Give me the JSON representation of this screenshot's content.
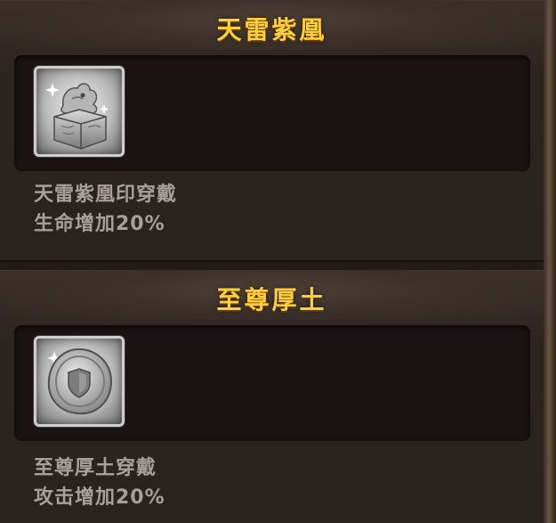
{
  "sets": [
    {
      "title": "天雷紫凰",
      "item_icon": "seal-icon",
      "description_line1": "天雷紫凰印穿戴",
      "description_line2": "生命增加20%"
    },
    {
      "title": "至尊厚土",
      "item_icon": "shield-coin-icon",
      "description_line1": "至尊厚土穿戴",
      "description_line2": "攻击增加20%"
    }
  ],
  "colors": {
    "title": "#ffcf3a",
    "description": "#a89f9b",
    "panel": "#2c241f",
    "slot_background": "#1b1214"
  }
}
